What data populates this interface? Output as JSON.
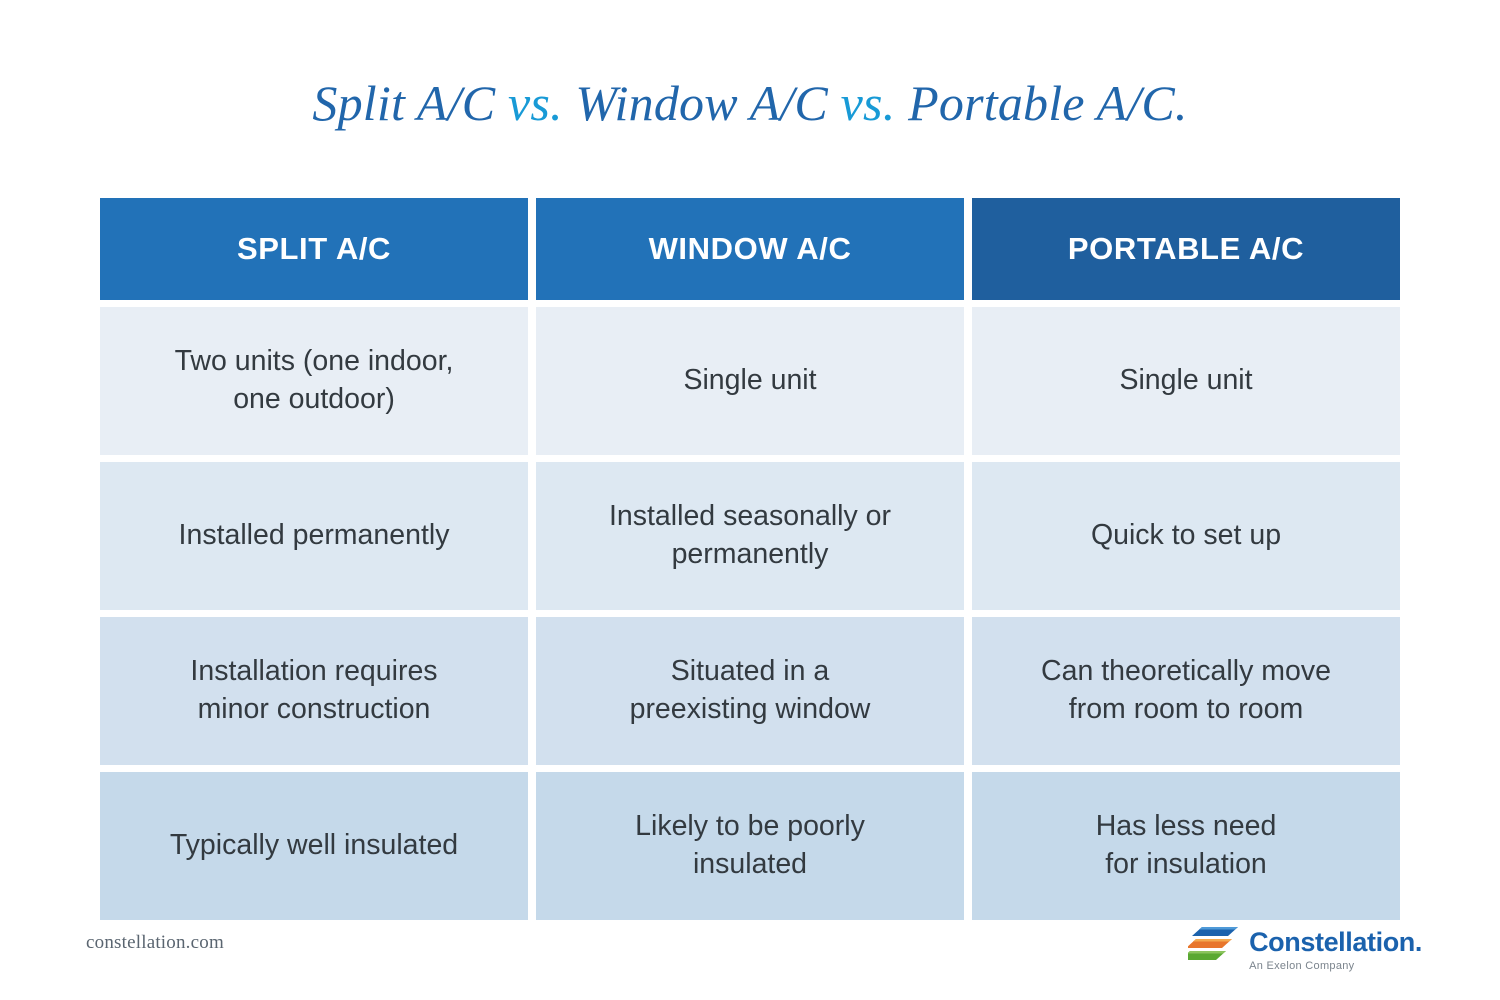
{
  "title": {
    "part1": "Split A/C ",
    "vs1": "vs.",
    "part2": " Window A/C ",
    "vs2": "vs.",
    "part3": " Portable A/C."
  },
  "table": {
    "headers": [
      "SPLIT A/C",
      "WINDOW A/C",
      "PORTABLE A/C"
    ],
    "rows": [
      {
        "cells": [
          [
            "Two units (one indoor,",
            "one outdoor)"
          ],
          [
            "Single unit"
          ],
          [
            "Single unit"
          ]
        ]
      },
      {
        "cells": [
          [
            "Installed permanently"
          ],
          [
            "Installed seasonally or",
            "permanently"
          ],
          [
            "Quick to set up"
          ]
        ]
      },
      {
        "cells": [
          [
            "Installation requires",
            "minor construction"
          ],
          [
            "Situated in a",
            "preexisting window"
          ],
          [
            "Can theoretically move",
            "from room to room"
          ]
        ]
      },
      {
        "cells": [
          [
            "Typically well insulated"
          ],
          [
            "Likely to be poorly",
            "insulated"
          ],
          [
            "Has less need",
            "for insulation"
          ]
        ]
      }
    ]
  },
  "footer": {
    "url": "constellation.com",
    "logo_word": "Constellation",
    "logo_dot": ".",
    "logo_tagline": "An Exelon Company"
  },
  "colors": {
    "title_main": "#2166ab",
    "title_vs": "#189ad6",
    "header_blue": "#2272b8",
    "header_blue_dark": "#1f5f9e",
    "row_tints": [
      "#e8eef5",
      "#dde8f2",
      "#d2e0ee",
      "#c5d9ea"
    ],
    "body_text": "#333a40",
    "logo_blue": "#1b62ad",
    "logo_orange": "#e8762c",
    "logo_green": "#5aa832"
  }
}
